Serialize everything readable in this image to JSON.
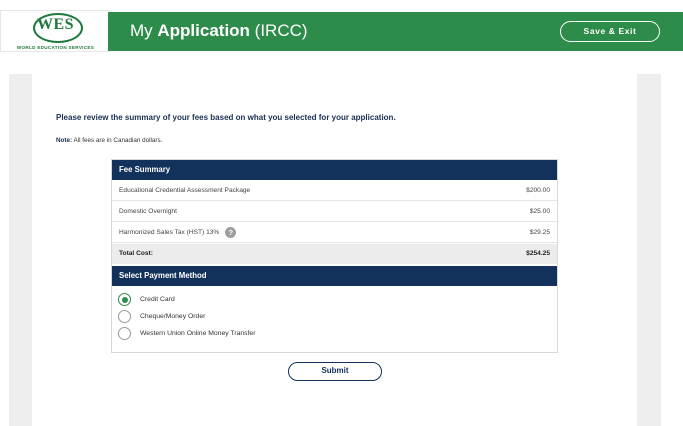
{
  "header": {
    "logo_text": "WES",
    "logo_subtext": "WORLD EDUCATION SERVICES",
    "title_prefix": "My ",
    "title_bold": "Application",
    "title_suffix": " (IRCC)",
    "save_exit_label": "Save & Exit"
  },
  "main": {
    "intro": "Please review the summary of your fees based on what you selected for your application.",
    "note_label": "Note:",
    "note_text": " All fees are in Canadian dollars."
  },
  "fee_summary": {
    "heading": "Fee Summary",
    "items": [
      {
        "label": "Educational Credential Assessment Package",
        "amount": "$200.00"
      },
      {
        "label": "Domestic Overnight",
        "amount": "$25.00"
      },
      {
        "label": "Harmonized Sales Tax (HST) 13%",
        "amount": "$29.25",
        "help": "?"
      }
    ],
    "total_label": "Total Cost:",
    "total_amount": "$254.25"
  },
  "payment": {
    "heading": "Select Payment Method",
    "options": [
      {
        "label": "Credit Card",
        "selected": true
      },
      {
        "label": "Cheque/Money Order",
        "selected": false
      },
      {
        "label": "Western Union Online Money Transfer",
        "selected": false
      }
    ]
  },
  "submit_label": "Submit",
  "colors": {
    "brand_green": "#2e8c4a",
    "navy": "#13325b"
  }
}
